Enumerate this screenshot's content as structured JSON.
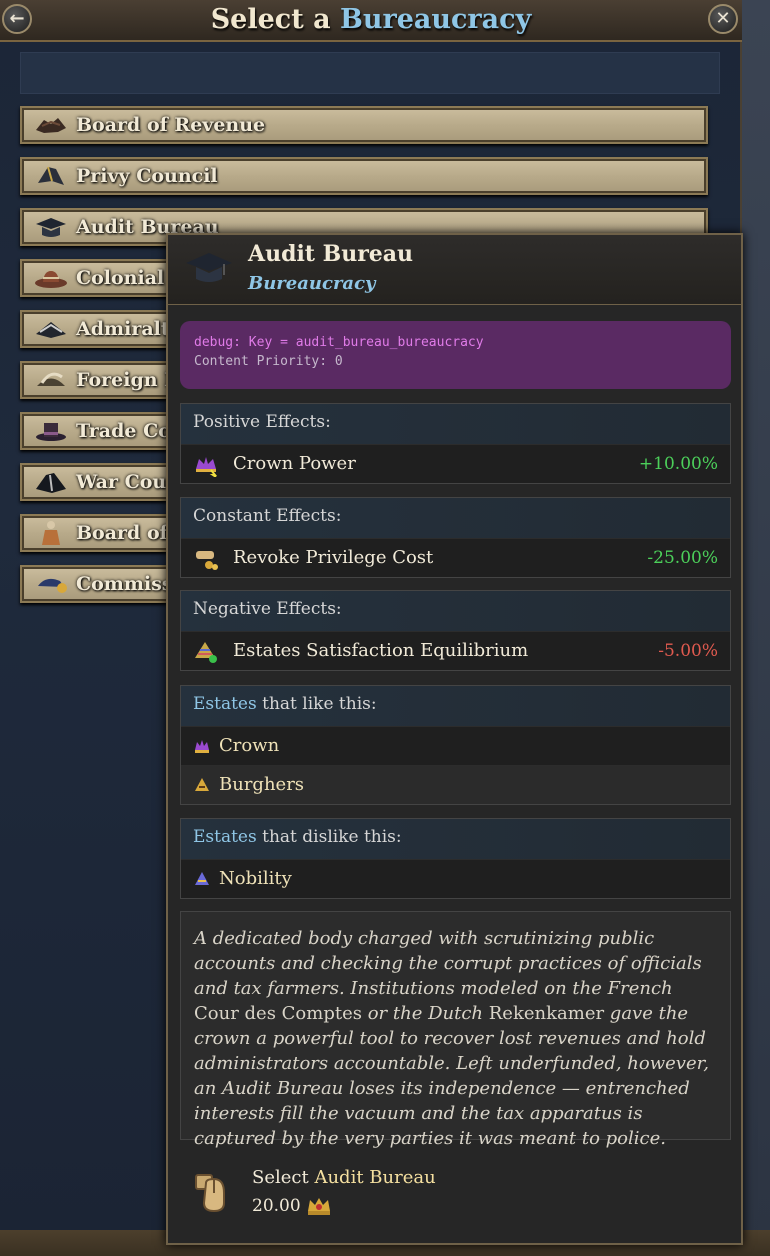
{
  "window": {
    "title_prefix": "Select a",
    "title_accent": "Bureaucracy",
    "back_icon": "arrow-left-icon",
    "close_icon": "close-icon"
  },
  "list": {
    "items": [
      {
        "label": "Board of Revenue",
        "icon": "tricorn-hat-icon"
      },
      {
        "label": "Privy Council",
        "icon": "bicorn-hat-icon"
      },
      {
        "label": "Audit Bureau",
        "icon": "mortarboard-icon"
      },
      {
        "label": "Colonial O",
        "icon": "wide-brim-hat-icon"
      },
      {
        "label": "Admiralty",
        "icon": "admiral-hat-icon"
      },
      {
        "label": "Foreign M",
        "icon": "feathered-hat-icon"
      },
      {
        "label": "Trade Com",
        "icon": "top-hat-icon"
      },
      {
        "label": "War Coun",
        "icon": "plumed-hat-icon"
      },
      {
        "label": "Board of C",
        "icon": "bottle-icon"
      },
      {
        "label": "Commissa",
        "icon": "cap-icon"
      }
    ]
  },
  "tooltip": {
    "title": "Audit Bureau",
    "subtitle": "Bureaucracy",
    "debug_key": "debug: Key = audit_bureau_bureaucracy",
    "debug_priority": "Content Priority: 0",
    "positive": {
      "header": "Positive Effects:",
      "rows": [
        {
          "label": "Crown Power",
          "value": "+10.00%",
          "icon": "crown-power-icon"
        }
      ]
    },
    "constant": {
      "header": "Constant Effects:",
      "rows": [
        {
          "label": "Revoke Privilege Cost",
          "value": "-25.00%",
          "icon": "scroll-gold-icon"
        }
      ]
    },
    "negative": {
      "header": "Negative Effects:",
      "rows": [
        {
          "label": "Estates Satisfaction Equilibrium",
          "value": "-5.00%",
          "icon": "estates-pyramid-icon"
        }
      ]
    },
    "likes": {
      "header_hl": "Estates",
      "header_rest": "that like this:",
      "rows": [
        {
          "label": "Crown",
          "icon": "crown-estate-icon"
        },
        {
          "label": "Burghers",
          "icon": "burghers-estate-icon"
        }
      ]
    },
    "dislikes": {
      "header_hl": "Estates",
      "header_rest": "that dislike this:",
      "rows": [
        {
          "label": "Nobility",
          "icon": "nobility-estate-icon"
        }
      ]
    },
    "description": {
      "part1": "A dedicated body charged with scrutinizing public accounts and checking the corrupt practices of officials and tax farmers. Institutions modeled on the French ",
      "upright1": "Cour des Comptes",
      "part2": " or the Dutch ",
      "upright2": "Rekenkamer",
      "part3": " gave the crown a powerful tool to recover lost revenues and hold administrators accountable. Left underfunded, however, an Audit Bureau loses its independence — entrenched interests fill the vacuum and the tax apparatus is captured by the very parties it was meant to police."
    },
    "select": {
      "prefix": "Select",
      "name": "Audit Bureau",
      "cost": "20.00",
      "cost_icon": "crown-cost-icon"
    }
  },
  "colors": {
    "accent_blue": "#8fc6e6",
    "positive": "#4cd05a",
    "negative": "#e05a4f",
    "debug_bg": "#5a2a63"
  }
}
